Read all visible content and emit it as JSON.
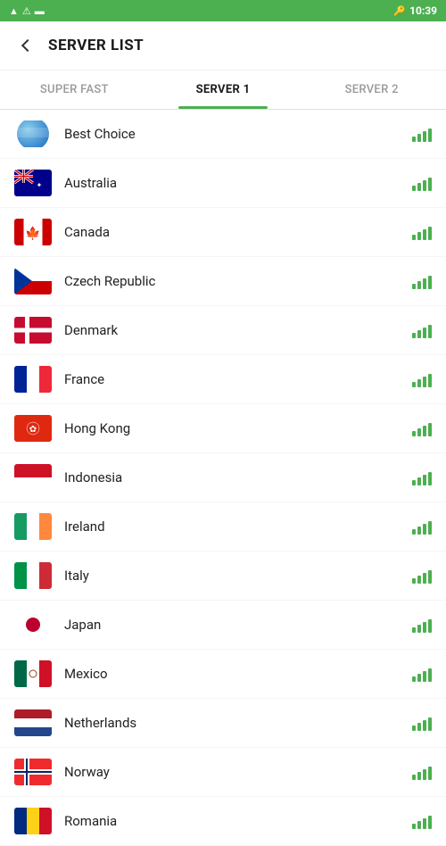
{
  "statusBar": {
    "time": "10:39"
  },
  "header": {
    "title": "SERVER LIST",
    "backLabel": "Back"
  },
  "tabs": [
    {
      "id": "super-fast",
      "label": "SUPER FAST",
      "active": false
    },
    {
      "id": "server-1",
      "label": "SERVER 1",
      "active": true
    },
    {
      "id": "server-2",
      "label": "SERVER 2",
      "active": false
    }
  ],
  "servers": [
    {
      "id": "best-choice",
      "name": "Best Choice",
      "flag": "globe"
    },
    {
      "id": "australia",
      "name": "Australia",
      "flag": "au"
    },
    {
      "id": "canada",
      "name": "Canada",
      "flag": "ca"
    },
    {
      "id": "czech-republic",
      "name": "Czech Republic",
      "flag": "cz"
    },
    {
      "id": "denmark",
      "name": "Denmark",
      "flag": "dk"
    },
    {
      "id": "france",
      "name": "France",
      "flag": "fr"
    },
    {
      "id": "hong-kong",
      "name": "Hong Kong",
      "flag": "hk"
    },
    {
      "id": "indonesia",
      "name": "Indonesia",
      "flag": "id"
    },
    {
      "id": "ireland",
      "name": "Ireland",
      "flag": "ie"
    },
    {
      "id": "italy",
      "name": "Italy",
      "flag": "it"
    },
    {
      "id": "japan",
      "name": "Japan",
      "flag": "jp"
    },
    {
      "id": "mexico",
      "name": "Mexico",
      "flag": "mx"
    },
    {
      "id": "netherlands",
      "name": "Netherlands",
      "flag": "nl"
    },
    {
      "id": "norway",
      "name": "Norway",
      "flag": "no"
    },
    {
      "id": "romania",
      "name": "Romania",
      "flag": "ro"
    }
  ]
}
